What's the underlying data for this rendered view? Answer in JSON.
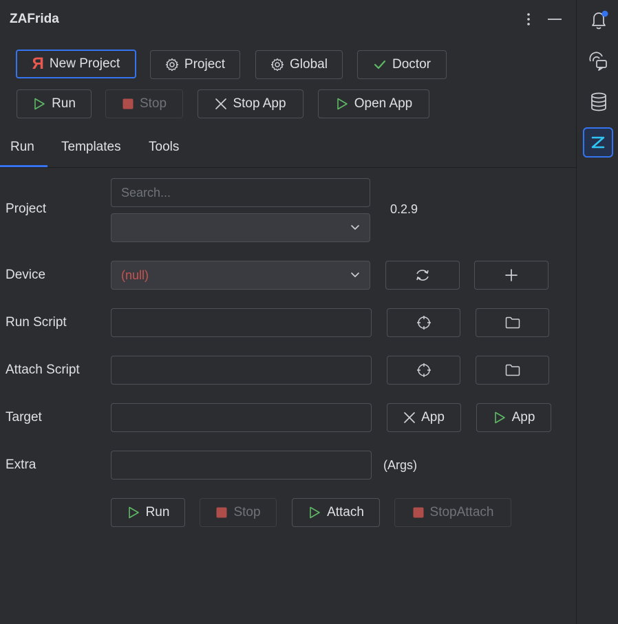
{
  "app": {
    "title": "ZAFrida"
  },
  "header": {
    "menu_icon": "kebab-menu-icon",
    "minimize_icon": "minimize-icon"
  },
  "toolbar": {
    "new_project": {
      "label": "New Project",
      "logo": "Я"
    },
    "project": "Project",
    "global": "Global",
    "doctor": "Doctor",
    "run": "Run",
    "stop": "Stop",
    "stop_app": "Stop App",
    "open_app": "Open App"
  },
  "tabs": [
    {
      "label": "Run",
      "active": true
    },
    {
      "label": "Templates",
      "active": false
    },
    {
      "label": "Tools",
      "active": false
    }
  ],
  "form": {
    "project_label": "Project",
    "search_placeholder": "Search...",
    "project_select_value": "",
    "version": "0.2.9",
    "device_label": "Device",
    "device_value": "(null)",
    "run_script_label": "Run Script",
    "run_script_value": "",
    "attach_script_label": "Attach Script",
    "attach_script_value": "",
    "target_label": "Target",
    "target_value": "",
    "stop_target_app": "App",
    "start_target_app": "App",
    "extra_label": "Extra",
    "extra_value": "",
    "args_hint": "(Args)"
  },
  "actions": {
    "run": "Run",
    "stop": "Stop",
    "attach": "Attach",
    "stop_attach": "StopAttach"
  },
  "colors": {
    "background": "#2b2d30",
    "accent": "#3574f0",
    "run_green": "#5fb865",
    "stop_red": "#c75450",
    "disabled_text": "#6f737a",
    "brand_red": "#e8594f",
    "notification_dot": "#3574f0",
    "active_tool_cyan": "#2fc6f6"
  },
  "right_rail": [
    {
      "icon": "notifications-bell-icon",
      "badge": true
    },
    {
      "icon": "ai-chat-icon"
    },
    {
      "icon": "database-icon"
    },
    {
      "icon": "zafrida-z-icon",
      "active": true
    }
  ]
}
